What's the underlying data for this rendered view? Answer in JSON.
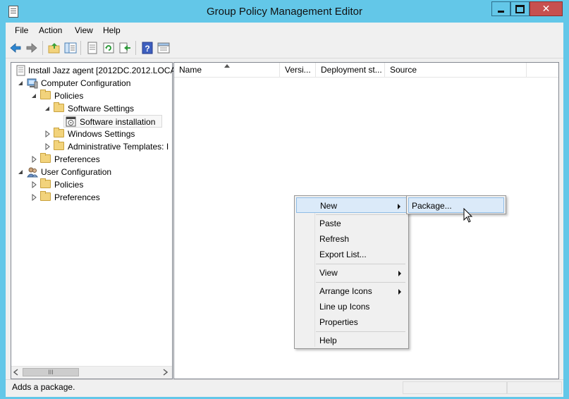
{
  "window": {
    "title": "Group Policy Management Editor",
    "min_glyph": "",
    "close_glyph": "✕"
  },
  "menubar": {
    "items": [
      "File",
      "Action",
      "View",
      "Help"
    ]
  },
  "tree": {
    "root": "Install Jazz agent [2012DC.2012.LOCAL",
    "computer_configuration": "Computer Configuration",
    "policies": "Policies",
    "software_settings": "Software Settings",
    "software_installation": "Software installation",
    "windows_settings": "Windows Settings",
    "administrative_templates": "Administrative Templates: I",
    "preferences": "Preferences",
    "user_configuration": "User Configuration",
    "user_policies": "Policies",
    "user_preferences": "Preferences",
    "scroll_thumb_glyph": "III"
  },
  "list": {
    "columns": [
      "Name",
      "Versi...",
      "Deployment st...",
      "Source"
    ]
  },
  "context_menu": {
    "new": "New",
    "paste": "Paste",
    "refresh": "Refresh",
    "export_list": "Export List...",
    "view": "View",
    "arrange_icons": "Arrange Icons",
    "line_up_icons": "Line up Icons",
    "properties": "Properties",
    "help": "Help"
  },
  "submenu": {
    "package": "Package..."
  },
  "status": {
    "text": "Adds a package."
  },
  "colors": {
    "title_bar": "#63c7e8",
    "close_button": "#c7504f",
    "highlight": "#dbeaf9"
  }
}
